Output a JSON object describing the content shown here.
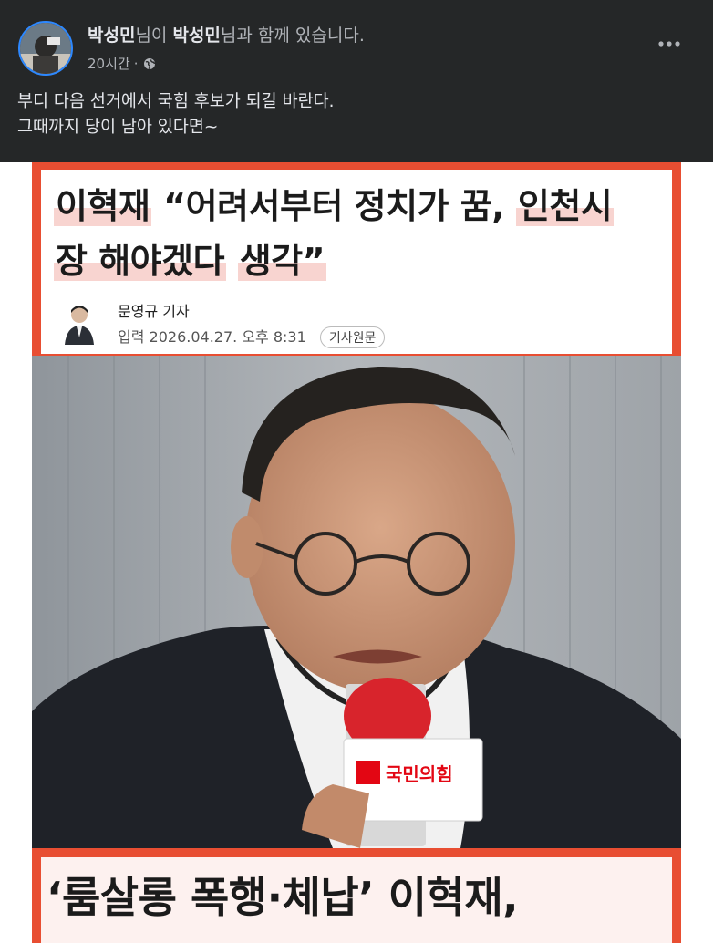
{
  "post": {
    "author": "박성민",
    "author_suffix": "님이 ",
    "tagged": "박성민",
    "tagged_suffix": "님과 함께 있습니다.",
    "time": "20시간",
    "separator": "·",
    "body_line1": "부디 다음 선거에서 국힘 후보가 되길 바란다.",
    "body_line2": "그때까지 당이 남아 있다면~"
  },
  "article": {
    "headline_name": "이혁재",
    "headline_part1": "“어려서부터 정치가 꿈,",
    "headline_part2": "인천시",
    "headline_line2a": "장 해야겠다",
    "headline_line2b": "생각”",
    "reporter": "문영규 기자",
    "date": "입력 2026.04.27. 오후 8:31",
    "badge": "기사원문",
    "mic_label": "국민의힘",
    "bottom_headline": "‘룸살롱 폭행·체납’ 이혁재,"
  },
  "colors": {
    "header_bg": "#252728",
    "frame_red": "#e84e32",
    "accent_blue": "#2d88ff"
  },
  "icons": [
    "globe-icon",
    "more-options-icon"
  ]
}
